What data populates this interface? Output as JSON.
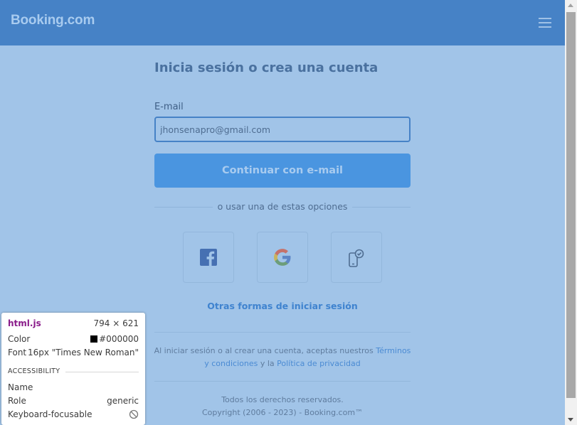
{
  "header": {
    "logo": "Booking.com",
    "menu_icon": "hamburger-icon"
  },
  "main": {
    "title": "Inicia sesión o crea una cuenta",
    "email_label": "E-mail",
    "email_value": "jhonsenapro@gmail.com",
    "continue_label": "Continuar con e-mail",
    "divider_text": "o usar una de estas opciones",
    "social": [
      "facebook-icon",
      "google-icon",
      "phone-check-icon"
    ],
    "other_options": "Otras formas de iniciar sesión",
    "legal": {
      "prefix": "Al iniciar sesión o al crear una cuenta, aceptas nuestros ",
      "terms": "Términos y condiciones",
      "middle": " y la ",
      "privacy": "Política de privacidad"
    },
    "footer": {
      "rights": "Todos los derechos reservados.",
      "copyright": "Copyright (2006 - 2023) - Booking.com™"
    }
  },
  "tooltip": {
    "name": "html.js",
    "size": "794 × 621",
    "color_label": "Color",
    "color_value": "#000000",
    "font_label": "Font",
    "font_value": "16px \"Times New Roman\"",
    "section": "ACCESSIBILITY",
    "name_label": "Name",
    "role_label": "Role",
    "role_value": "generic",
    "focus_label": "Keyboard-focusable"
  },
  "colors": {
    "header": "#4682c6",
    "overlay_bg": "#a1c4e8",
    "button": "#4a95e0",
    "link": "#3f83cf"
  }
}
